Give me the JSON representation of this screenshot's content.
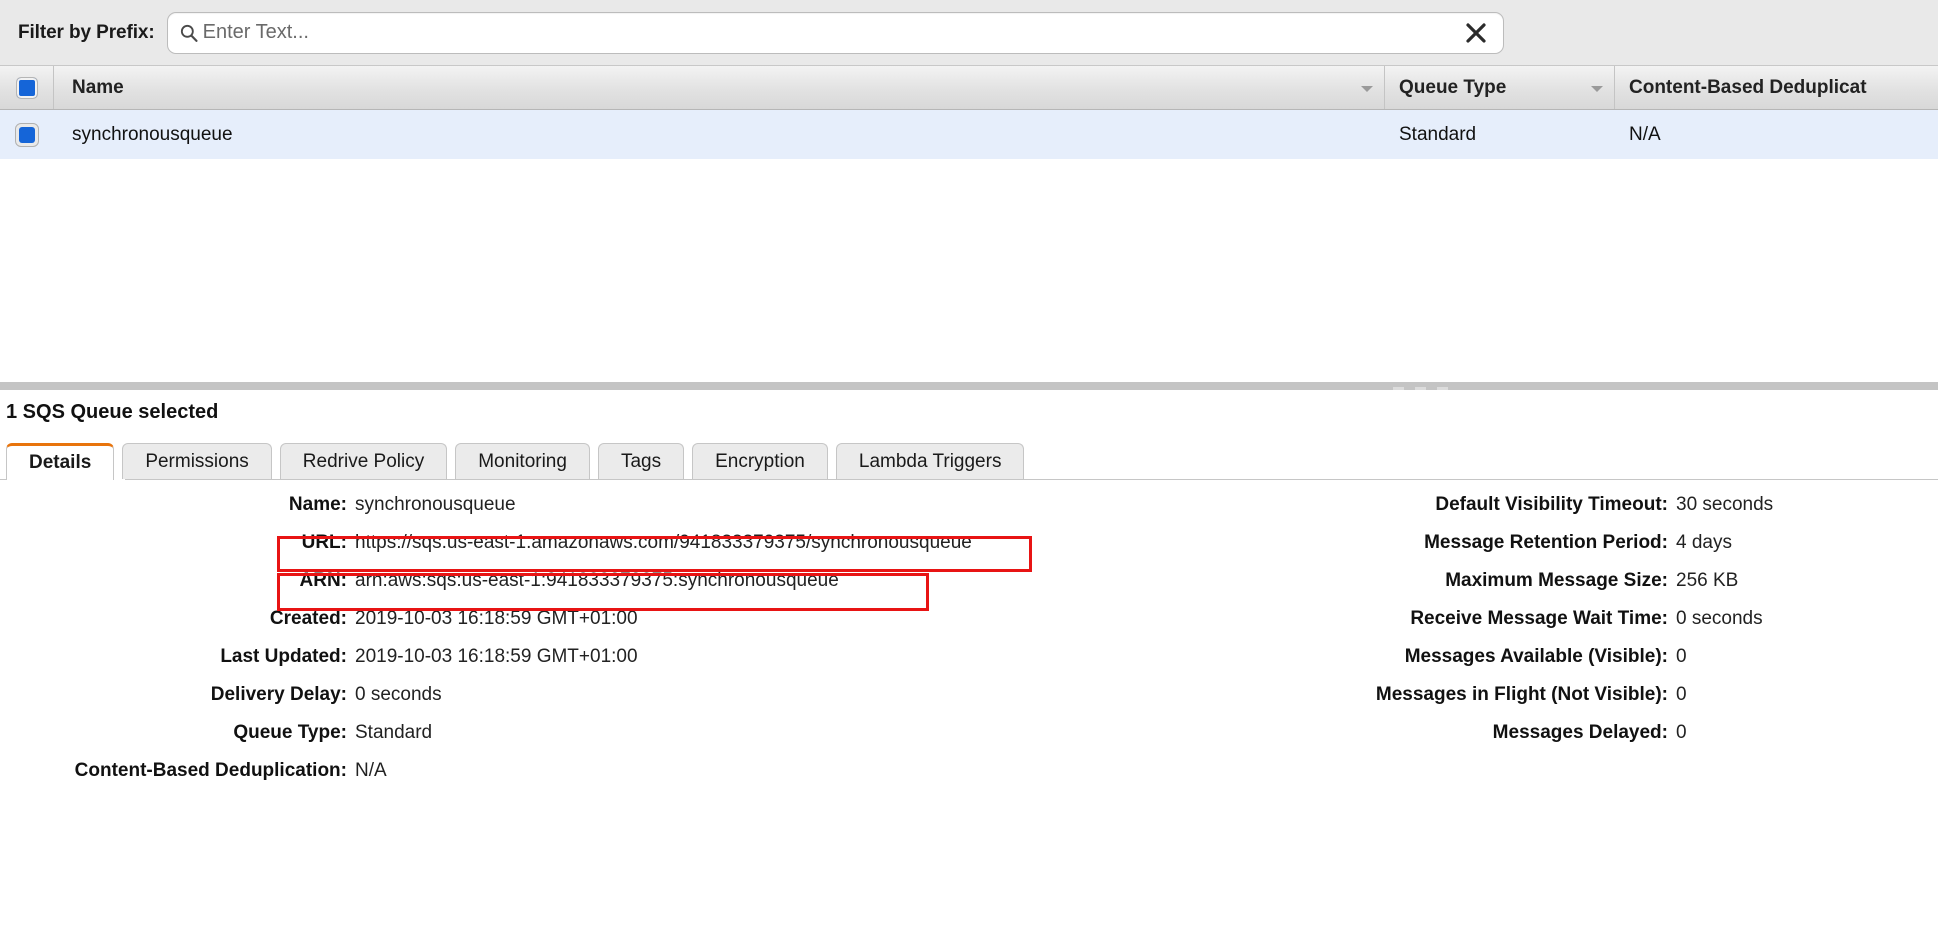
{
  "filter": {
    "label": "Filter by Prefix:",
    "placeholder": "Enter Text...",
    "value": "",
    "search_icon": "search-icon",
    "clear_icon": "close-icon"
  },
  "table": {
    "columns": [
      {
        "key": "name",
        "label": "Name",
        "sortable": true
      },
      {
        "key": "queue_type",
        "label": "Queue Type",
        "sortable": true
      },
      {
        "key": "content_based_dedup",
        "label": "Content-Based Deduplicat"
      }
    ],
    "rows": [
      {
        "selected": true,
        "name": "synchronousqueue",
        "queue_type": "Standard",
        "content_based_dedup": "N/A"
      }
    ]
  },
  "detail": {
    "selected_count_text": "1 SQS Queue selected",
    "tabs": [
      {
        "label": "Details",
        "active": true
      },
      {
        "label": "Permissions",
        "active": false
      },
      {
        "label": "Redrive Policy",
        "active": false
      },
      {
        "label": "Monitoring",
        "active": false
      },
      {
        "label": "Tags",
        "active": false
      },
      {
        "label": "Encryption",
        "active": false
      },
      {
        "label": "Lambda Triggers",
        "active": false
      }
    ],
    "left_fields": [
      {
        "label": "Name:",
        "value": "synchronousqueue",
        "highlight": false
      },
      {
        "label": "URL:",
        "value": "https://sqs.us-east-1.amazonaws.com/941833379375/synchronousqueue",
        "highlight": true
      },
      {
        "label": "ARN:",
        "value": "arn:aws:sqs:us-east-1:941833379375:synchronousqueue",
        "highlight": true
      },
      {
        "label": "Created:",
        "value": "2019-10-03 16:18:59 GMT+01:00",
        "highlight": false
      },
      {
        "label": "Last Updated:",
        "value": "2019-10-03 16:18:59 GMT+01:00",
        "highlight": false
      },
      {
        "label": "Delivery Delay:",
        "value": "0 seconds",
        "highlight": false
      },
      {
        "label": "Queue Type:",
        "value": "Standard",
        "highlight": false
      },
      {
        "label": "Content-Based Deduplication:",
        "value": "N/A",
        "highlight": false
      }
    ],
    "right_fields": [
      {
        "label": "Default Visibility Timeout:",
        "value": "30 seconds"
      },
      {
        "label": "Message Retention Period:",
        "value": "4 days"
      },
      {
        "label": "Maximum Message Size:",
        "value": "256 KB"
      },
      {
        "label": "Receive Message Wait Time:",
        "value": "0 seconds"
      },
      {
        "label": "Messages Available (Visible):",
        "value": "0"
      },
      {
        "label": "Messages in Flight (Not Visible):",
        "value": "0"
      },
      {
        "label": "Messages Delayed:",
        "value": "0"
      }
    ]
  },
  "colors": {
    "accent_orange": "#e8740c",
    "highlight_red": "#e81414",
    "selected_row_blue": "#e6eefb",
    "checkbox_blue": "#1565d8"
  }
}
